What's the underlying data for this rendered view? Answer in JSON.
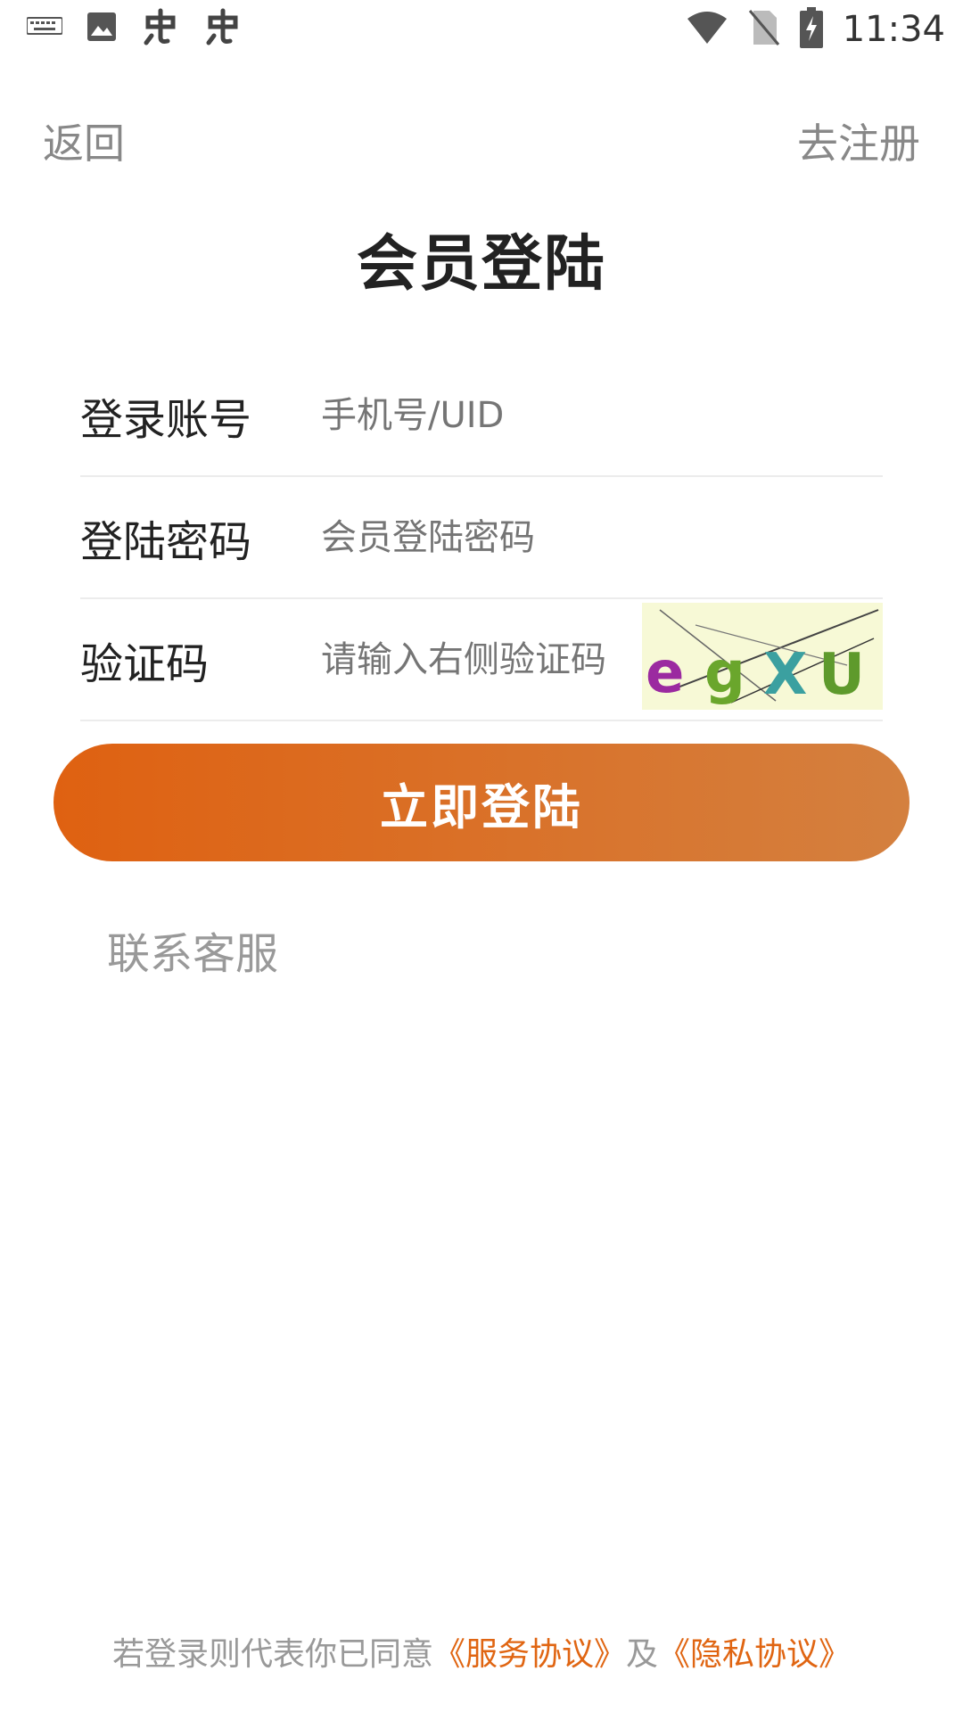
{
  "status_bar": {
    "left_icons": [
      "keyboard-icon",
      "image-icon",
      "app-icon",
      "app-icon"
    ],
    "right_icons": [
      "wifi-icon",
      "no-sim-icon",
      "battery-charging-icon"
    ],
    "time": "11:34"
  },
  "nav": {
    "back_label": "返回",
    "register_label": "去注册"
  },
  "title": "会员登陆",
  "form": {
    "account": {
      "label": "登录账号",
      "placeholder": "手机号/UID"
    },
    "password": {
      "label": "登陆密码",
      "placeholder": "会员登陆密码"
    },
    "captcha": {
      "label": "验证码",
      "placeholder": "请输入右侧验证码",
      "code_text": "egXU"
    }
  },
  "login_button": "立即登陆",
  "contact_label": "联系客服",
  "footer": {
    "prefix": "若登录则代表你已同意",
    "service_link": "《服务协议》",
    "conjunction": "及",
    "privacy_link": "《隐私协议》"
  },
  "colors": {
    "accent": "#e06512",
    "button_start": "#df6111",
    "button_end": "#d4803f"
  }
}
